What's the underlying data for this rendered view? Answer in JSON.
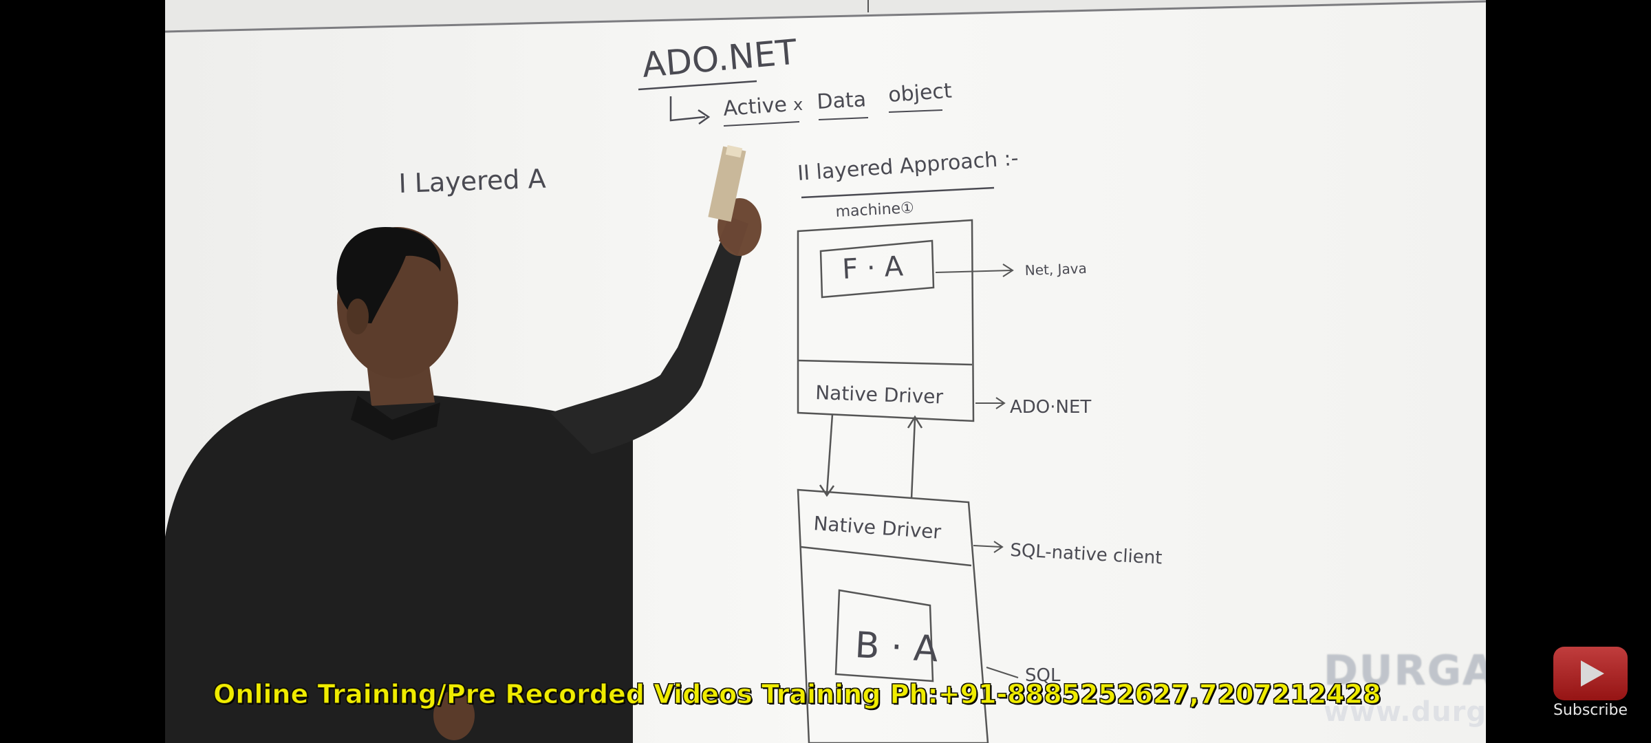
{
  "board": {
    "title": "ADO.NET",
    "subtitle_parts": [
      "Active",
      "x",
      "Data",
      "object"
    ],
    "section_1": "I  Layered A",
    "section_2": "II  layered Approach :-",
    "machine_label": "machine①",
    "fa_label": "F · A",
    "fa_note": "Net, Java",
    "native_driver_top": "Native Driver",
    "native_driver_top_note": "ADO·NET",
    "native_driver_bottom": "Native Driver",
    "native_driver_bottom_note": "SQL-native client",
    "ba_label": "B · A",
    "ba_note": "SQL"
  },
  "overlay": {
    "brand": "DURGASOFT",
    "url": "www.durgasoft.com",
    "ticker": "Online Training/Pre Recorded Videos Training Ph:+91-8885252627,7207212428"
  },
  "subscribe": {
    "label": "Subscribe",
    "icon": "play-icon"
  },
  "colors": {
    "board": "#f4f4f2",
    "marker": "#4a4a52",
    "ticker": "#f0ec00",
    "subscribe": "#c62828",
    "background": "#000000"
  }
}
